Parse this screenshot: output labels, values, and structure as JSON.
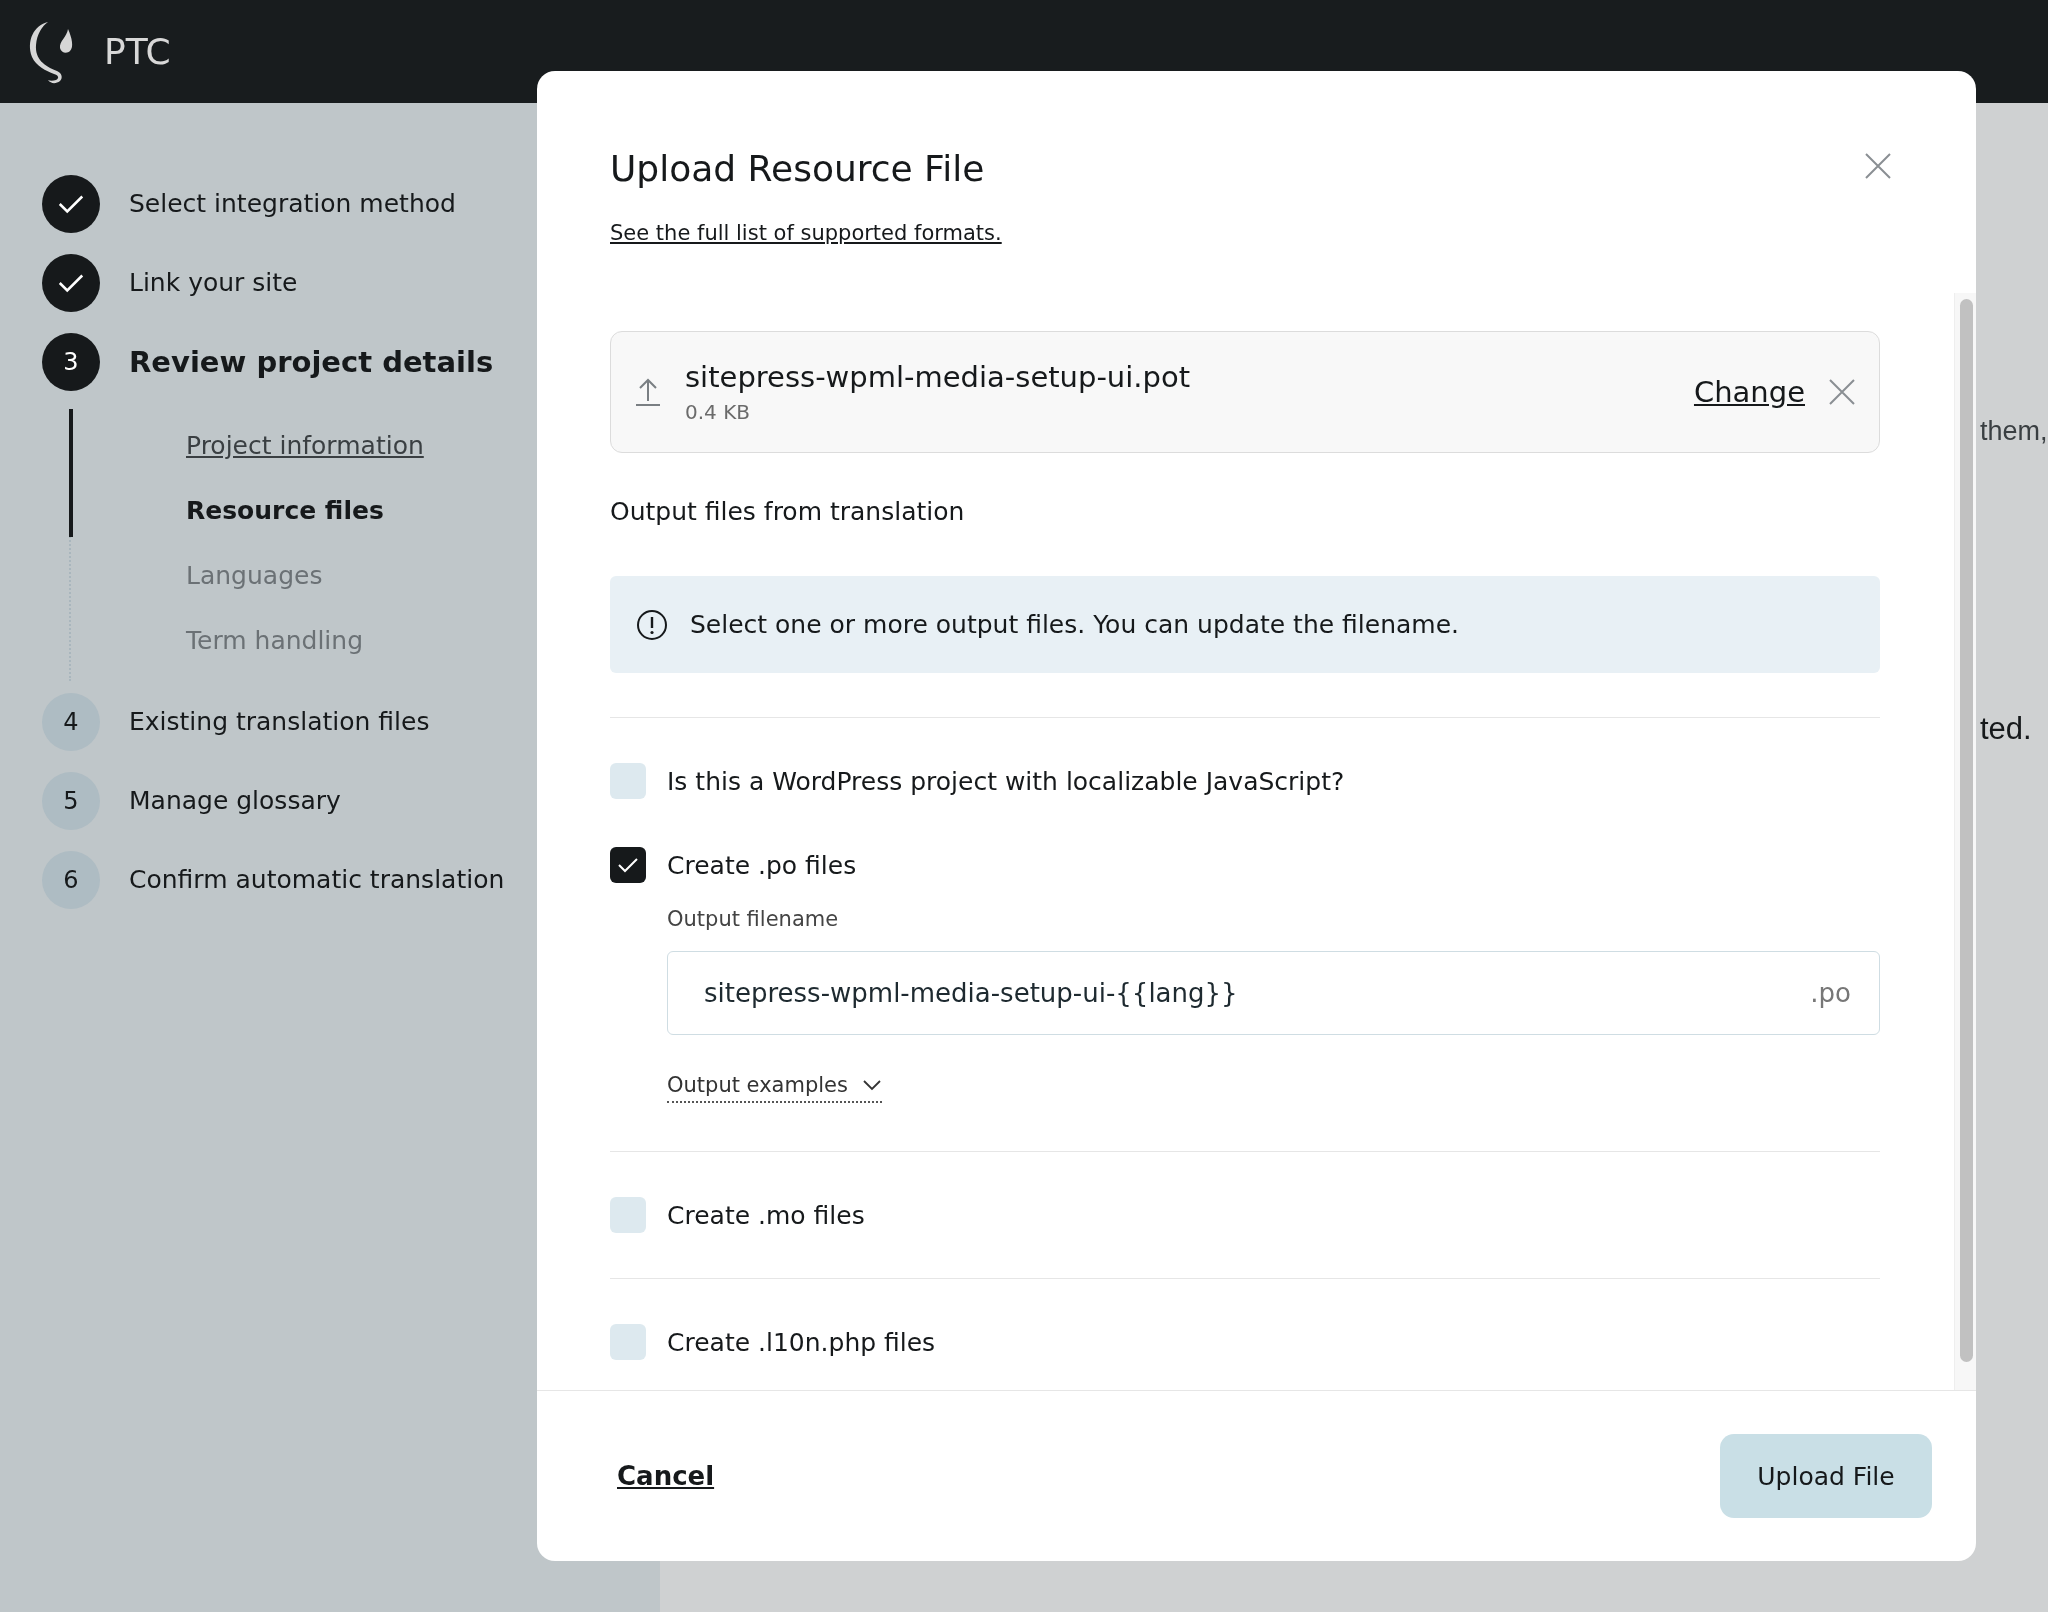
{
  "header": {
    "brand": "PTC"
  },
  "steps": [
    {
      "label": "Select integration method",
      "done": true,
      "selected": false
    },
    {
      "label": "Link your site",
      "done": true,
      "selected": false
    },
    {
      "number": "3",
      "label": "Review project details",
      "done": false,
      "selected": true,
      "substeps": [
        {
          "label": "Project information",
          "done": true,
          "selected": false
        },
        {
          "label": "Resource files",
          "done": false,
          "selected": true
        },
        {
          "label": "Languages",
          "done": false,
          "selected": false
        },
        {
          "label": "Term handling",
          "done": false,
          "selected": false
        }
      ]
    },
    {
      "number": "4",
      "label": "Existing translation files",
      "done": false,
      "selected": false
    },
    {
      "number": "5",
      "label": "Manage glossary",
      "done": false,
      "selected": false
    },
    {
      "number": "6",
      "label": "Confirm automatic translation",
      "done": false,
      "selected": false
    }
  ],
  "background_text": [
    "them,",
    "ted."
  ],
  "modal": {
    "title": "Upload Resource File",
    "formats_link": "See the full list of supported formats.",
    "file": {
      "name": "sitepress-wpml-media-setup-ui.pot",
      "size": "0.4 KB",
      "change": "Change"
    },
    "output_heading": "Output files from translation",
    "info": "Select one or more output files. You can update the filename.",
    "options": [
      {
        "label": "Is this a WordPress project with localizable JavaScript?",
        "checked": false
      },
      {
        "label": "Create .po files",
        "checked": true,
        "filename_label": "Output filename",
        "filename": "sitepress-wpml-media-setup-ui-{{lang}}",
        "extension": ".po",
        "examples": "Output examples"
      },
      {
        "label": "Create .mo files",
        "checked": false
      },
      {
        "label": "Create .l10n.php files",
        "checked": false
      }
    ],
    "cancel": "Cancel",
    "submit": "Upload File"
  }
}
